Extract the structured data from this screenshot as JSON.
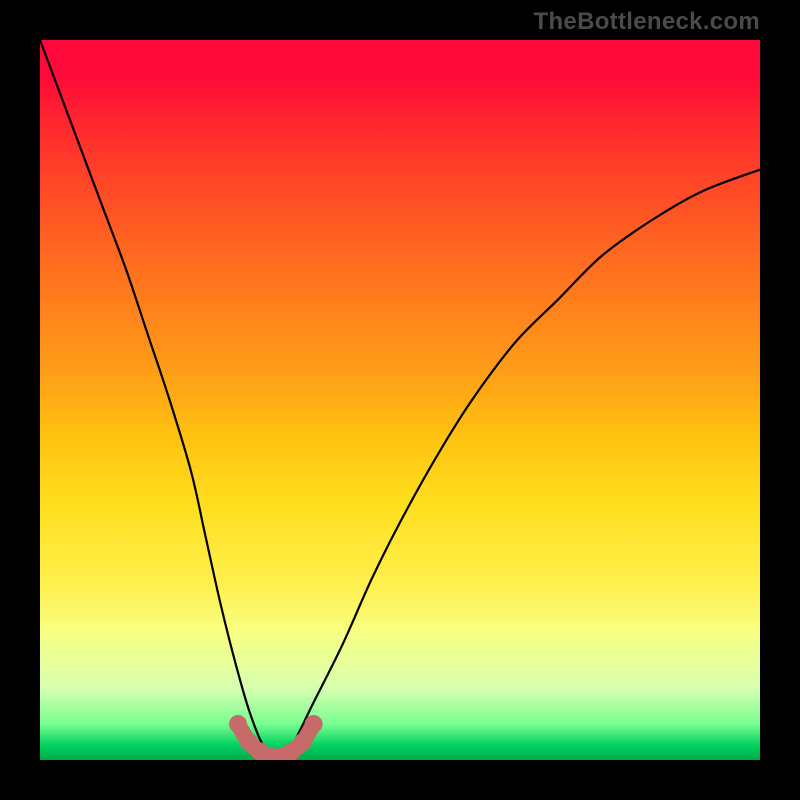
{
  "attribution": "TheBottleneck.com",
  "chart_data": {
    "type": "line",
    "title": "",
    "xlabel": "",
    "ylabel": "",
    "xlim": [
      0,
      100
    ],
    "ylim": [
      0,
      100
    ],
    "series": [
      {
        "name": "bottleneck-curve",
        "x": [
          0,
          3,
          6,
          9,
          12,
          15,
          18,
          21,
          23,
          25,
          27,
          29,
          31,
          33,
          35,
          38,
          42,
          46,
          50,
          55,
          60,
          66,
          72,
          78,
          85,
          92,
          100
        ],
        "y": [
          100,
          92,
          84,
          76,
          68,
          59,
          50,
          40,
          31,
          22,
          14,
          7,
          2,
          0,
          2,
          8,
          16,
          25,
          33,
          42,
          50,
          58,
          64,
          70,
          75,
          79,
          82
        ]
      }
    ],
    "markers": {
      "name": "optimal-range",
      "x": [
        27.5,
        29.0,
        30.5,
        32.0,
        33.5,
        35.0,
        36.5,
        38.0
      ],
      "y": [
        5.0,
        2.5,
        1.2,
        0.5,
        0.5,
        1.2,
        2.5,
        5.0
      ]
    },
    "colors": {
      "curve": "#000000",
      "marker": "#c76a6a",
      "gradient_top": "#ff0a3a",
      "gradient_bottom": "#00a848"
    }
  }
}
